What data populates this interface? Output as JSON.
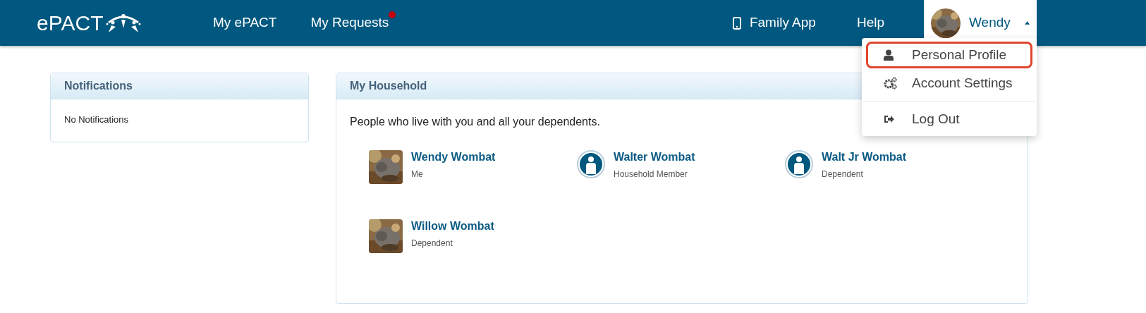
{
  "header": {
    "logo": "ePACT",
    "nav": [
      {
        "label": "My ePACT",
        "badge": false
      },
      {
        "label": "My Requests",
        "badge": true
      }
    ],
    "family_app": "Family App",
    "help": "Help",
    "user": {
      "name": "Wendy",
      "expanded": true
    }
  },
  "user_menu": [
    {
      "label": "Personal Profile",
      "selected": true,
      "kind": "item"
    },
    {
      "label": "Account Settings",
      "selected": false,
      "kind": "item"
    },
    {
      "kind": "divider"
    },
    {
      "label": "Log Out",
      "selected": false,
      "kind": "item"
    }
  ],
  "notifications": {
    "title": "Notifications",
    "text": "No Notifications"
  },
  "household": {
    "title": "My Household",
    "description": "People who live with you and all your dependents.",
    "people": [
      {
        "name": "Wendy Wombat",
        "role": "Me"
      },
      {
        "name": "Walter Wombat",
        "role": "Household Member",
        "kind": "default"
      },
      {
        "name": "Walt Jr Wombat",
        "role": "Dependent",
        "kind": "default"
      },
      {
        "name": "Willow Wombat",
        "role": "Dependent"
      }
    ]
  }
}
